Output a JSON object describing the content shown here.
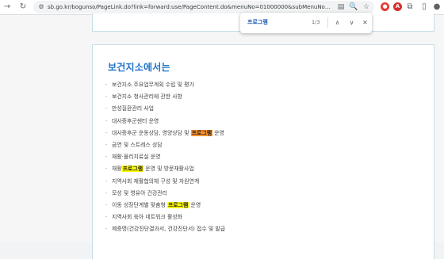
{
  "browser": {
    "url": "sb.go.kr/bogunso/PageLink.do?link=forward:use/PageContent.do&menuNo=01000000&subMenuNo=01030000&thirdMe..."
  },
  "find": {
    "query": "프로그램",
    "count": "1/3"
  },
  "content": {
    "title": "보건지소에서는",
    "items": [
      {
        "pre": "보건지소 주요업무계획 수립 및 평가",
        "hl": "",
        "post": ""
      },
      {
        "pre": "보건지소 청사관리에 관한 사항",
        "hl": "",
        "post": ""
      },
      {
        "pre": "만성질환관리 사업",
        "hl": "",
        "post": ""
      },
      {
        "pre": "대사증후군센터 운영",
        "hl": "",
        "post": ""
      },
      {
        "pre": "대사증후군 운동상담, 영양상담 및 ",
        "hl": "프로그램",
        "post": " 운영",
        "active": true
      },
      {
        "pre": "금연 및 스트레스 상담",
        "hl": "",
        "post": ""
      },
      {
        "pre": "재활·물리치료실 운영",
        "hl": "",
        "post": ""
      },
      {
        "pre": "재활",
        "hl": "프로그램",
        "post": " 운영 및 방문재활사업"
      },
      {
        "pre": "지역사회 재활협의체 구성 및 자원연계",
        "hl": "",
        "post": ""
      },
      {
        "pre": "모성 및 영유아 건강관리",
        "hl": "",
        "post": ""
      },
      {
        "pre": "이동 성장단계별 맞춤형 ",
        "hl": "프로그램",
        "post": " 운영"
      },
      {
        "pre": "지역사회 육아 네트워크 활성화",
        "hl": "",
        "post": ""
      },
      {
        "pre": "제증명(건강진단결과서, 건강진단서) 접수 및 발급",
        "hl": "",
        "post": ""
      }
    ]
  }
}
